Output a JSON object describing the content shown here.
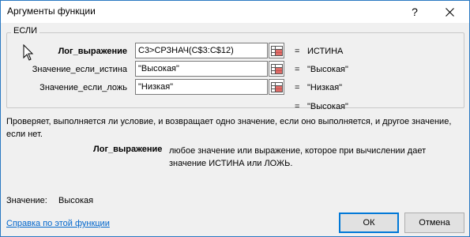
{
  "window": {
    "title": "Аргументы функции",
    "help_glyph": "?",
    "close_icon": "close-icon"
  },
  "function": {
    "name": "ЕСЛИ",
    "arguments": [
      {
        "label": "Лог_выражение",
        "bold": true,
        "value": "C3>СРЗНАЧ(C$3:C$12)",
        "result": "ИСТИНА"
      },
      {
        "label": "Значение_если_истина",
        "bold": false,
        "value": "\"Высокая\"",
        "result": "\"Высокая\""
      },
      {
        "label": "Значение_если_ложь",
        "bold": false,
        "value": "\"Низкая\"",
        "result": "\"Низкая\""
      }
    ],
    "equals": "=",
    "overall_result": "\"Высокая\""
  },
  "description": "Проверяет, выполняется ли условие, и возвращает одно значение, если оно выполняется, и другое значение, если нет.",
  "arg_help": {
    "name": "Лог_выражение",
    "text": "любое значение или выражение, которое при вычислении дает значение ИСТИНА или ЛОЖЬ."
  },
  "value_row": {
    "label": "Значение:",
    "value": "Высокая"
  },
  "footer": {
    "help_link": "Справка по этой функции",
    "ok_label": "ОК",
    "cancel_label": "Отмена"
  }
}
